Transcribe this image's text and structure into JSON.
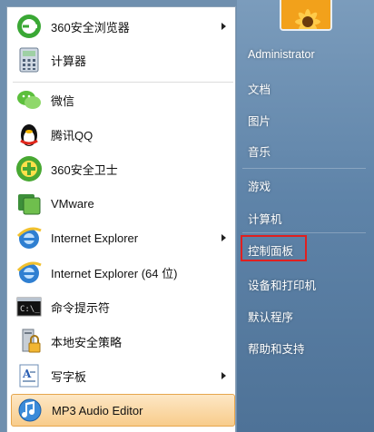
{
  "left_menu": {
    "items": [
      {
        "label": "360安全浏览器",
        "icon": "360-browser-icon",
        "has_submenu": true
      },
      {
        "label": "计算器",
        "icon": "calculator-icon",
        "has_submenu": false
      },
      {
        "label": "微信",
        "icon": "wechat-icon",
        "has_submenu": false
      },
      {
        "label": "腾讯QQ",
        "icon": "qq-penguin-icon",
        "has_submenu": false
      },
      {
        "label": "360安全卫士",
        "icon": "360-safeguard-icon",
        "has_submenu": false
      },
      {
        "label": "VMware",
        "icon": "vmware-icon",
        "has_submenu": false
      },
      {
        "label": "Internet Explorer",
        "icon": "internet-explorer-icon",
        "has_submenu": true
      },
      {
        "label": "Internet Explorer (64 位)",
        "icon": "internet-explorer-icon",
        "has_submenu": false
      },
      {
        "label": "命令提示符",
        "icon": "command-prompt-icon",
        "has_submenu": false
      },
      {
        "label": "本地安全策略",
        "icon": "security-policy-icon",
        "has_submenu": false
      },
      {
        "label": "写字板",
        "icon": "wordpad-icon",
        "has_submenu": true
      },
      {
        "label": "MP3 Audio Editor",
        "icon": "mp3-audio-editor-icon",
        "has_submenu": false,
        "highlighted": true
      }
    ]
  },
  "right_panel": {
    "user": "Administrator",
    "links": [
      "文档",
      "图片",
      "音乐",
      "游戏",
      "计算机",
      "控制面板",
      "设备和打印机",
      "默认程序",
      "帮助和支持"
    ],
    "annotated_link": "控制面板",
    "annotation_color": "#e02020"
  },
  "colors": {
    "panel_blue": "#5f84a9",
    "highlight": "#f8cc8b"
  }
}
